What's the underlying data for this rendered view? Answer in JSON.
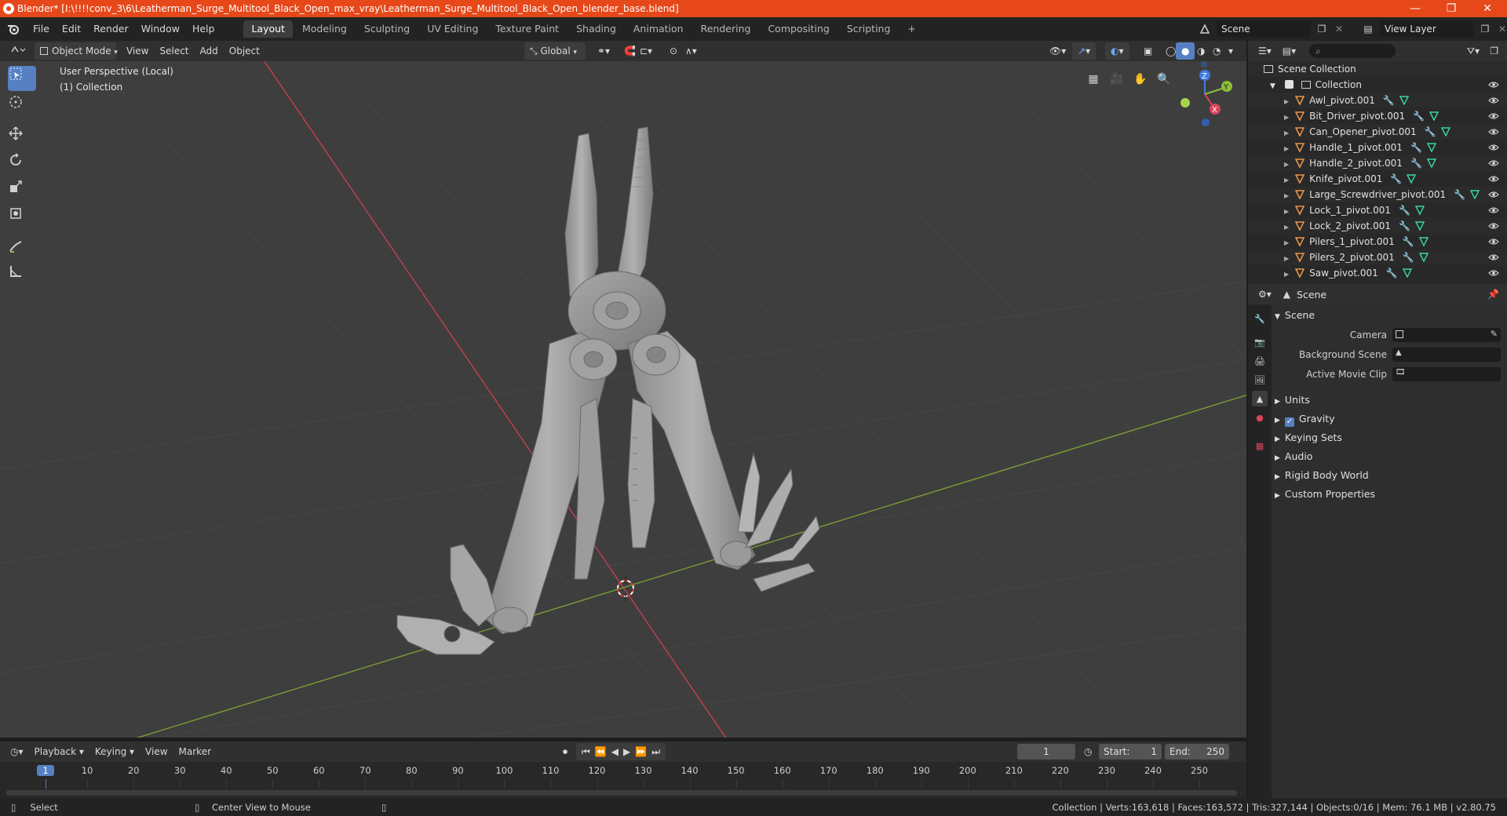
{
  "window": {
    "title": "Blender* [I:\\!!!!conv_3\\6\\Leatherman_Surge_Multitool_Black_Open_max_vray\\Leatherman_Surge_Multitool_Black_Open_blender_base.blend]",
    "minimize": "—",
    "maximize": "❐",
    "close": "✕"
  },
  "menus": [
    "File",
    "Edit",
    "Render",
    "Window",
    "Help"
  ],
  "workspaces": [
    "Layout",
    "Modeling",
    "Sculpting",
    "UV Editing",
    "Texture Paint",
    "Shading",
    "Animation",
    "Rendering",
    "Compositing",
    "Scripting"
  ],
  "active_workspace": "Layout",
  "add_workspace": "+",
  "scene_field": "Scene",
  "view_layer_field": "View Layer",
  "viewport_header": {
    "mode": "Object Mode",
    "menus": [
      "View",
      "Select",
      "Add",
      "Object"
    ],
    "transform_orientation": "Global"
  },
  "viewport": {
    "perspective_label": "User Perspective (Local)",
    "collection_label": "(1) Collection",
    "gizmo": {
      "z": "Z",
      "y": "Y",
      "x": "X"
    }
  },
  "outliner": {
    "root": "Scene Collection",
    "collection": "Collection",
    "items": [
      "Awl_pivot.001",
      "Bit_Driver_pivot.001",
      "Can_Opener_pivot.001",
      "Handle_1_pivot.001",
      "Handle_2_pivot.001",
      "Knife_pivot.001",
      "Large_Screwdriver_pivot.001",
      "Lock_1_pivot.001",
      "Lock_2_pivot.001",
      "Pilers_1_pivot.001",
      "Pilers_2_pivot.001",
      "Saw_pivot.001"
    ]
  },
  "properties": {
    "context": "Scene",
    "section": "Scene",
    "rows": [
      {
        "label": "Camera"
      },
      {
        "label": "Background Scene"
      },
      {
        "label": "Active Movie Clip"
      }
    ],
    "panels": [
      "Units",
      "Gravity",
      "Keying Sets",
      "Audio",
      "Rigid Body World",
      "Custom Properties"
    ],
    "gravity_checked": true
  },
  "timeline_header": {
    "menus": [
      "Playback",
      "Keying",
      "View",
      "Marker"
    ],
    "current_frame": "1",
    "start_label": "Start:",
    "start": "1",
    "end_label": "End:",
    "end": "250"
  },
  "timeline": {
    "ticks": [
      "1",
      "10",
      "20",
      "30",
      "40",
      "50",
      "60",
      "70",
      "80",
      "90",
      "100",
      "110",
      "120",
      "130",
      "140",
      "150",
      "160",
      "170",
      "180",
      "190",
      "200",
      "210",
      "220",
      "230",
      "240",
      "250"
    ]
  },
  "status": {
    "left_action": "Select",
    "middle_action": "Center View to Mouse",
    "stats": "Collection | Verts:163,618 | Faces:163,572 | Tris:327,144 | Objects:0/16 | Mem: 76.1 MB | v2.80.75"
  },
  "colors": {
    "title_bar": "#e6481a",
    "accent": "#5680c2",
    "x_axis": "#d9445b",
    "y_axis": "#8bbf3a",
    "z_axis": "#3f7be0",
    "object_icon": "#e8954a",
    "modifier_icon": "#6fa8ff",
    "mesh_icon": "#3ad6a0"
  }
}
